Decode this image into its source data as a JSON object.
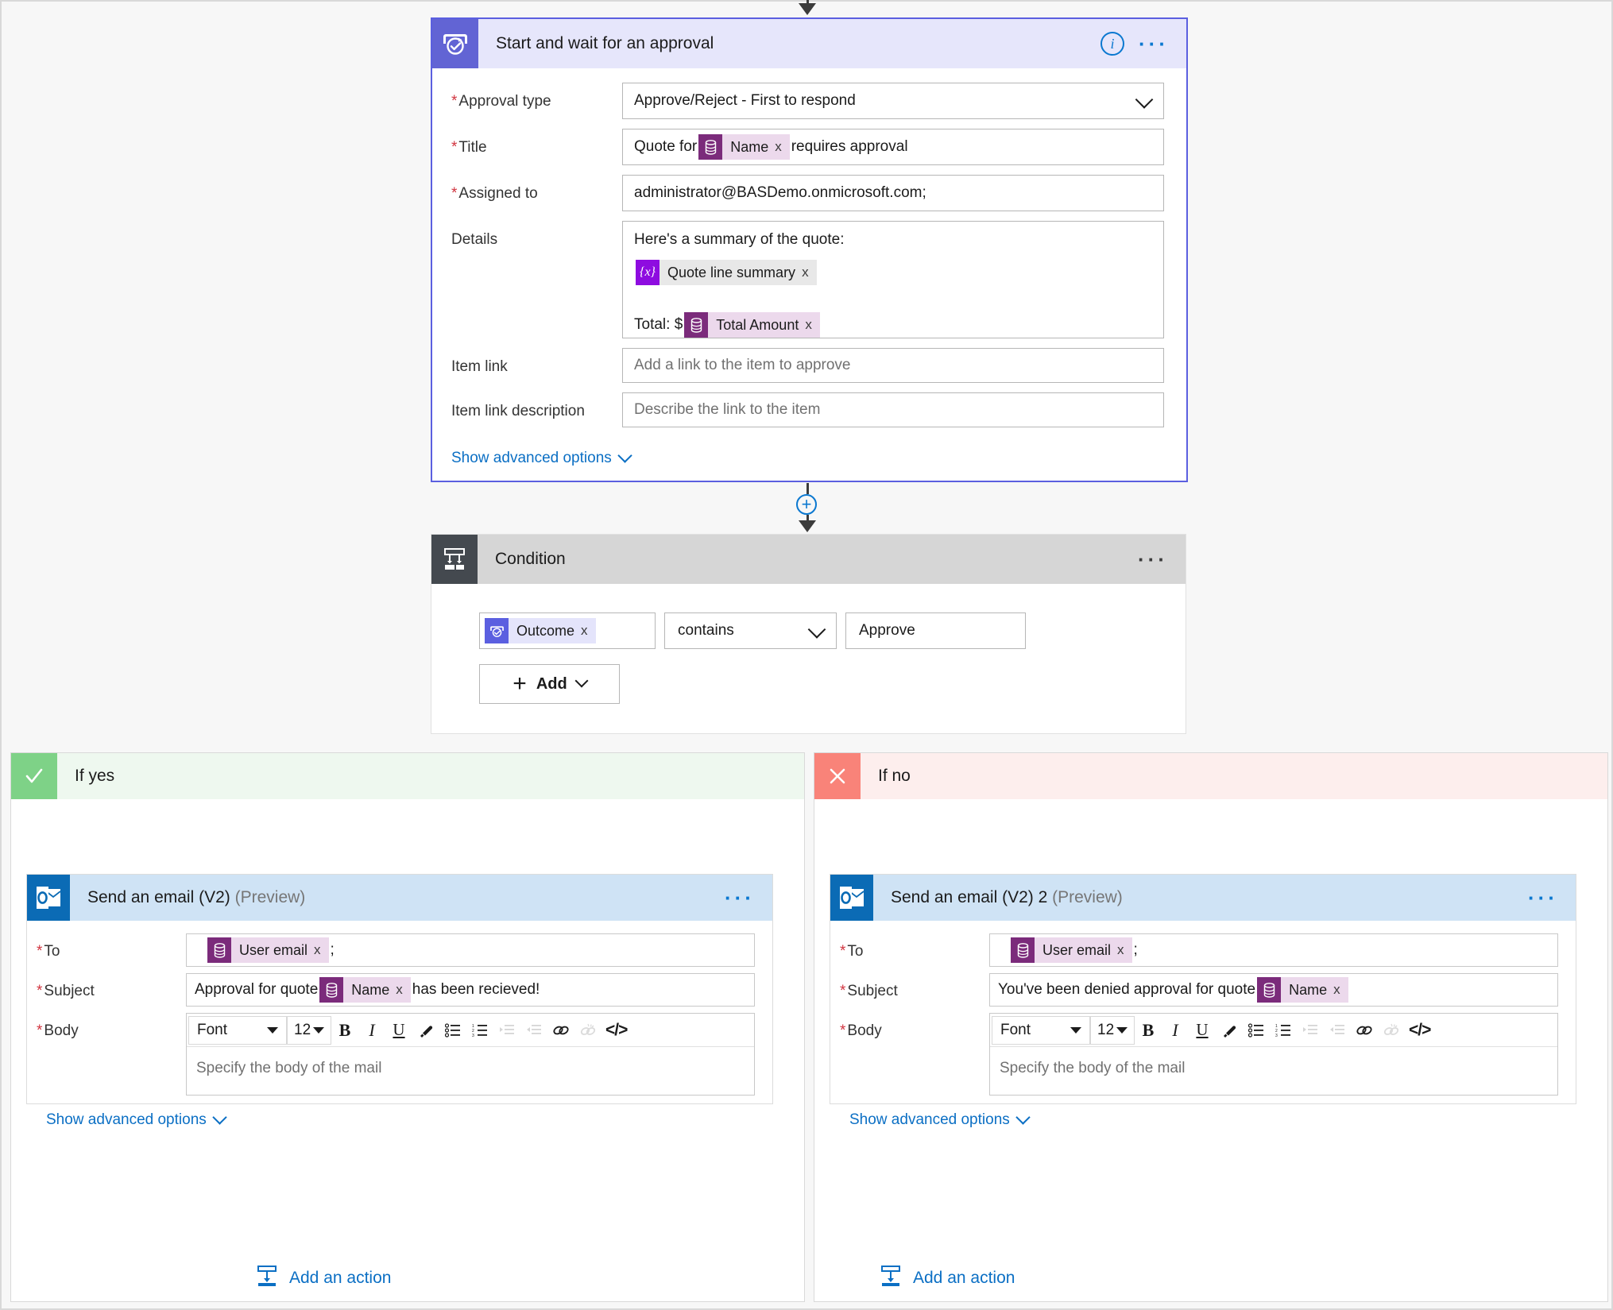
{
  "flow": {
    "approval_card": {
      "title": "Start and wait for an approval",
      "icon": "approvals-icon",
      "info_icon": "info-icon",
      "more_icon": "more-options-icon",
      "fields": {
        "approval_type": {
          "label": "Approval type",
          "required": true,
          "value": "Approve/Reject - First to respond"
        },
        "title": {
          "label": "Title",
          "required": true,
          "prefix_text": "Quote for",
          "token": "Name",
          "suffix_text": "requires approval"
        },
        "assigned_to": {
          "label": "Assigned to",
          "required": true,
          "value": "administrator@BASDemo.onmicrosoft.com;"
        },
        "details": {
          "label": "Details",
          "required": false,
          "line1": "Here's a summary of the quote:",
          "token1": "Quote line summary",
          "total_prefix": "Total: $",
          "token2": "Total Amount"
        },
        "item_link": {
          "label": "Item link",
          "required": false,
          "placeholder": "Add a link to the item to approve"
        },
        "item_link_description": {
          "label": "Item link description",
          "required": false,
          "placeholder": "Describe the link to the item"
        }
      },
      "show_advanced": "Show advanced options"
    },
    "condition_card": {
      "title": "Condition",
      "icon": "condition-branch-icon",
      "more_icon": "more-options-icon",
      "left_token": "Outcome",
      "operator": "contains",
      "right_value": "Approve",
      "add_button": "Add"
    },
    "branch_yes": {
      "label": "If yes",
      "badge_icon": "check-icon",
      "add_action": "Add an action",
      "email": {
        "title": "Send an email (V2)",
        "preview_suffix": "(Preview)",
        "icon": "outlook-icon",
        "more_icon": "more-options-icon",
        "to": {
          "label": "To",
          "required": true,
          "token": "User email",
          "suffix": ";"
        },
        "subject": {
          "label": "Subject",
          "required": true,
          "prefix_text": "Approval for quote",
          "token": "Name",
          "suffix_text": "has been recieved!"
        },
        "body": {
          "label": "Body",
          "required": true,
          "placeholder": "Specify the body of the mail",
          "font_name": "Font",
          "font_size": "12"
        },
        "show_advanced": "Show advanced options"
      }
    },
    "branch_no": {
      "label": "If no",
      "badge_icon": "close-icon",
      "add_action": "Add an action",
      "email": {
        "title": "Send an email (V2) 2",
        "preview_suffix": "(Preview)",
        "icon": "outlook-icon",
        "more_icon": "more-options-icon",
        "to": {
          "label": "To",
          "required": true,
          "token": "User email",
          "suffix": ";"
        },
        "subject": {
          "label": "Subject",
          "required": true,
          "prefix_text": "You've been denied approval for quote",
          "token": "Name",
          "suffix_text": ""
        },
        "body": {
          "label": "Body",
          "required": true,
          "placeholder": "Specify the body of the mail",
          "font_name": "Font",
          "font_size": "12"
        },
        "show_advanced": "Show advanced options"
      }
    },
    "toolbar_icons": [
      "bold-icon",
      "italic-icon",
      "underline-icon",
      "text-color-icon",
      "bulleted-list-icon",
      "numbered-list-icon",
      "increase-indent-icon",
      "decrease-indent-icon",
      "link-icon",
      "unlink-icon",
      "code-view-icon"
    ],
    "connector": {
      "insert_icon": "plus-icon",
      "arrow_icon": "arrow-down-icon"
    },
    "token_remove_label": "x",
    "colors": {
      "approval_accent": "#6264d4",
      "approval_header_bg": "#e6e6fb",
      "condition_accent": "#44494f",
      "condition_header_bg": "#d6d6d6",
      "yes_accent": "#7ed287",
      "yes_header_bg": "#eef8ef",
      "no_accent": "#f98379",
      "no_header_bg": "#fdeeed",
      "outlook_blue": "#0b6bb5",
      "email_header_bg": "#cfe3f5",
      "link_blue": "#0b6fc4",
      "token_purple": "#7b2b7b",
      "token_purple_bg": "#ecd9ec",
      "variable_purple": "#8e0ce0",
      "required_red": "#d1343f"
    }
  }
}
